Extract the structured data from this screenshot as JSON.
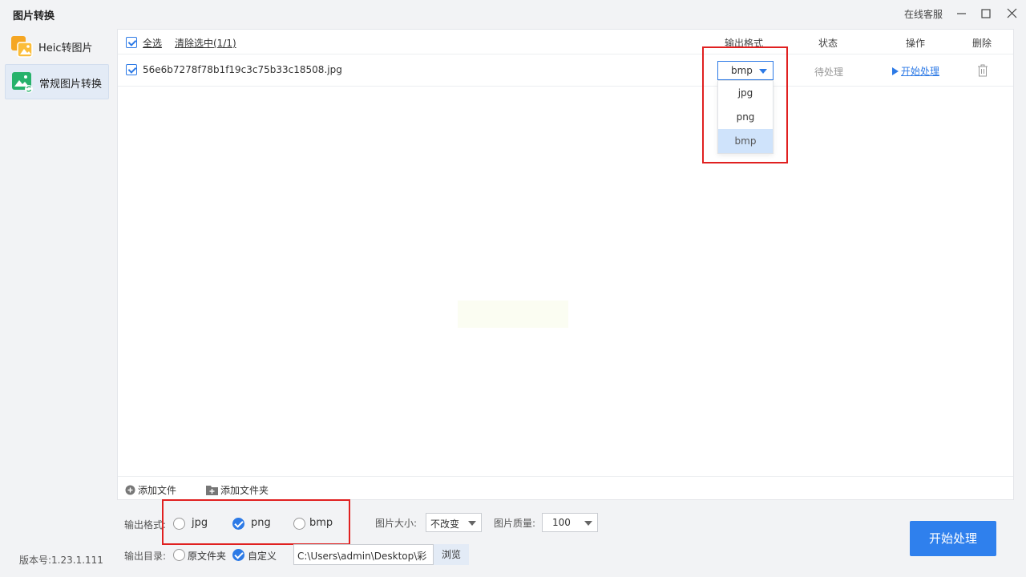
{
  "window": {
    "title": "图片转换",
    "service_label": "在线客服"
  },
  "sidebar": {
    "items": [
      {
        "label": "Heic转图片",
        "icon": "heic-image-icon",
        "active": false
      },
      {
        "label": "常规图片转换",
        "icon": "image-convert-icon",
        "active": true
      }
    ],
    "version": "版本号:1.23.1.111"
  },
  "list": {
    "select_all": "全选",
    "clear_selection": "清除选中(1/1)",
    "columns": {
      "output_format": "输出格式",
      "status": "状态",
      "action": "操作",
      "delete": "删除"
    },
    "rows": [
      {
        "checked": true,
        "filename": "56e6b7278f78b1f19c3c75b33c18508.jpg",
        "format": "bmp",
        "status": "待处理",
        "action": "开始处理"
      }
    ],
    "format_dropdown": {
      "options": [
        "jpg",
        "png",
        "bmp"
      ],
      "selected": "bmp"
    }
  },
  "add_bar": {
    "add_file": "添加文件",
    "add_folder": "添加文件夹"
  },
  "bottom": {
    "output_format_label": "输出格式:",
    "format_options": [
      "jpg",
      "png",
      "bmp"
    ],
    "format_selected": "png",
    "size_label": "图片大小:",
    "size_value": "不改变",
    "quality_label": "图片质量:",
    "quality_value": "100",
    "output_dir_label": "输出目录:",
    "dir_options": [
      "原文件夹",
      "自定义"
    ],
    "dir_selected": "自定义",
    "path_value": "C:\\Users\\admin\\Desktop\\彩",
    "browse": "浏览",
    "start": "开始处理"
  },
  "colors": {
    "accent": "#2d7ae6",
    "primary_button": "#2f80ed",
    "highlight_box": "#e02020",
    "dropdown_selected": "#cfe3fb"
  }
}
